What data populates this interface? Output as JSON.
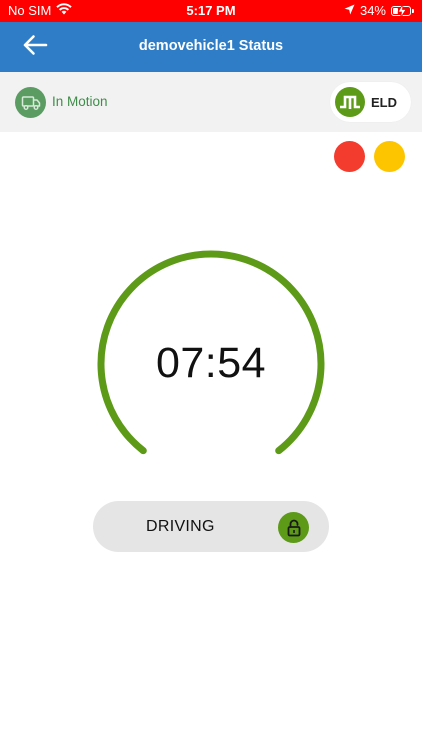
{
  "status_bar": {
    "carrier": "No SIM",
    "time": "5:17 PM",
    "battery_text": "34%",
    "battery_level": 0.34,
    "wifi_icon": "wifi-icon",
    "location_icon": "location-arrow-icon",
    "battery_icon": "battery-charging-icon"
  },
  "header": {
    "title": "demovehicle1 Status",
    "back_icon": "arrow-left-icon"
  },
  "info_bar": {
    "motion_status": "In Motion",
    "motion_icon": "truck-icon",
    "eld_label": "ELD",
    "eld_icon": "eld-signal-icon"
  },
  "indicators": [
    {
      "name": "red",
      "color": "#f33b2e"
    },
    {
      "name": "yellow",
      "color": "#fdc500"
    }
  ],
  "timer": {
    "value": "07:54",
    "ring_color": "#5c9a18"
  },
  "duty_status": {
    "label": "DRIVING",
    "lock_icon": "unlock-icon"
  },
  "colors": {
    "status_bar": "#ff0000",
    "header": "#2e7dc6",
    "accent_green": "#5c9a18",
    "motion_green": "#3f8d4a"
  }
}
